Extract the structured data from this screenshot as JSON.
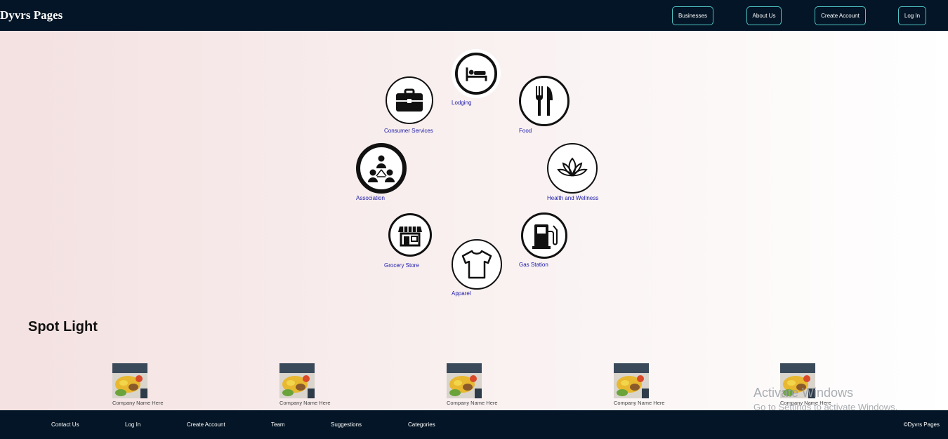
{
  "header": {
    "brand": "Dyvrs Pages",
    "nav": [
      "Businesses",
      "About Us",
      "Create Account",
      "Log In"
    ]
  },
  "categories": {
    "lodging": "Lodging",
    "consumer_services": "Consumer Services",
    "food": "Food",
    "association": "Association",
    "health": "Health and Wellness",
    "grocery": "Grocery Store",
    "gas": "Gas Station",
    "apparel": "Apparel"
  },
  "spotlight": {
    "title": "Spot Light",
    "companies": [
      "Company Name Here",
      "Company Name Here",
      "Company Name Here",
      "Company Name Here",
      "Company Name Here"
    ]
  },
  "watermark": {
    "line1": "Activate Windows",
    "line2": "Go to Settings to activate Windows."
  },
  "footer": {
    "links": [
      "Contact Us",
      "Log In",
      "Create Account",
      "Team",
      "Suggestions",
      "Categories"
    ],
    "copyright": "©Dyvrs Pages"
  },
  "colors": {
    "header_bg": "#031526",
    "button_border": "#4fc3c3",
    "label_blue": "#1a1aa8"
  }
}
